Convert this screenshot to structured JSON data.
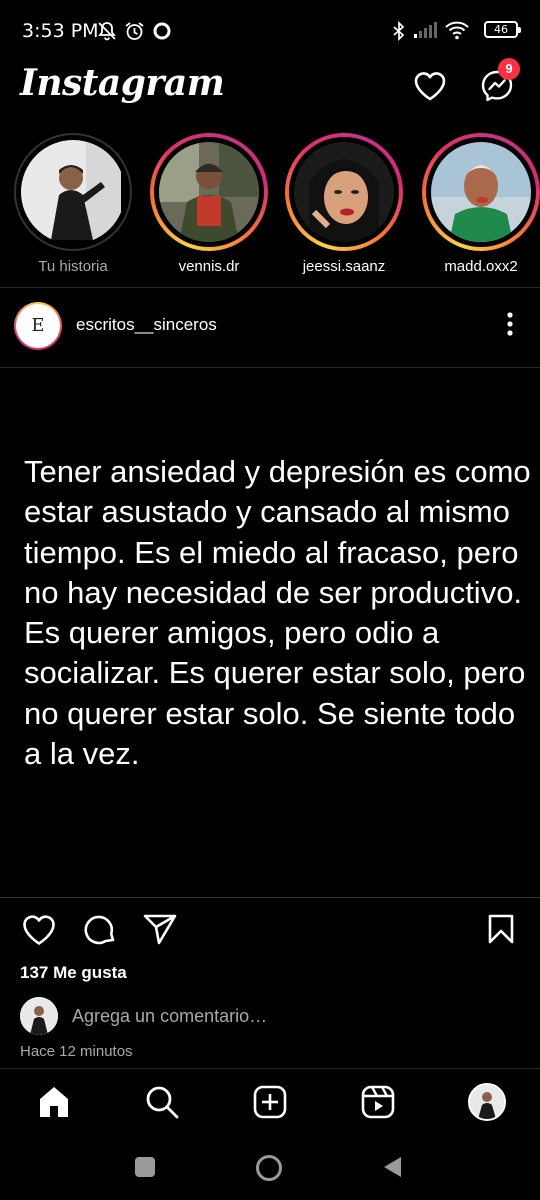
{
  "status_bar": {
    "time": "3:53 PM",
    "battery": "46",
    "icons": [
      "mute-notifications-icon",
      "alarm-icon",
      "record-icon",
      "bluetooth-icon",
      "signal-icon",
      "wifi-icon",
      "battery-icon"
    ]
  },
  "header": {
    "logo": "Instagram",
    "messages_badge": "9",
    "accent": "#ff3040"
  },
  "stories": [
    {
      "label": "Tu historia",
      "own": true
    },
    {
      "label": "vennis.dr"
    },
    {
      "label": "jeessi.saanz"
    },
    {
      "label": "madd.oxx2"
    }
  ],
  "post": {
    "username": "escritos__sinceros",
    "avatar_text": "E",
    "text": "Tener ansiedad y depresión es como estar asustado y cansado al mismo tiempo. Es el miedo al fracaso, pero no hay necesidad de ser productivo. Es querer amigos, pero odio a socializar. Es querer estar solo, pero no querer estar solo. Se siente todo a la vez.",
    "likes": "137 Me gusta",
    "comment_placeholder": "Agrega un comentario…",
    "time_ago": "Hace 12 minutos"
  },
  "bottom_nav": [
    "home-icon",
    "search-icon",
    "new-post-icon",
    "reels-icon",
    "profile-avatar"
  ],
  "system_nav": [
    "recents-button",
    "home-button",
    "back-button"
  ]
}
